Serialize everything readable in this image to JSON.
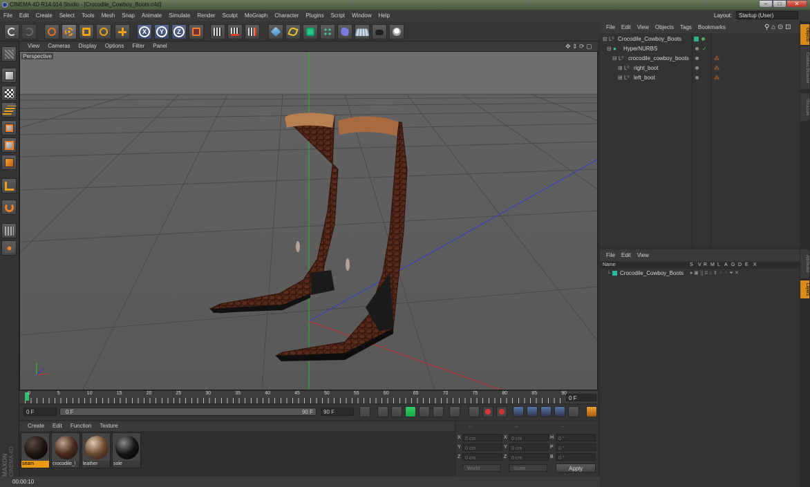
{
  "window": {
    "title": "CINEMA 4D R14.014 Studio - [Crocodile_Cowboy_Boots.c4d]",
    "controls": [
      "–",
      "□",
      "✕"
    ]
  },
  "menu": [
    "File",
    "Edit",
    "Create",
    "Select",
    "Tools",
    "Mesh",
    "Snap",
    "Animate",
    "Simulate",
    "Render",
    "Sculpt",
    "MoGraph",
    "Character",
    "Plugins",
    "Script",
    "Window",
    "Help"
  ],
  "layout": {
    "label": "Layout:",
    "value": "Startup (User)"
  },
  "toolbar": {
    "axes": [
      "X",
      "Y",
      "Z"
    ],
    "icons": [
      "undo-icon",
      "redo-icon",
      "live-selection-icon",
      "move-icon",
      "scale-icon",
      "rotate-icon",
      "add-object-icon",
      "x-axis-icon",
      "y-axis-icon",
      "z-axis-icon",
      "coordinate-system-icon",
      "render-view-icon",
      "render-picture-viewer-icon",
      "edit-render-settings-icon",
      "cube-icon",
      "spline-icon",
      "nurbs-icon",
      "array-icon",
      "deformer-icon",
      "floor-icon",
      "camera-icon",
      "light-icon"
    ]
  },
  "viewport": {
    "menu": [
      "View",
      "Cameras",
      "Display",
      "Options",
      "Filter",
      "Panel"
    ],
    "label": "Perspective"
  },
  "timeline": {
    "ticks": [
      "0",
      "5",
      "10",
      "15",
      "20",
      "25",
      "30",
      "35",
      "40",
      "45",
      "50",
      "55",
      "60",
      "65",
      "70",
      "75",
      "80",
      "85",
      "90"
    ],
    "current_frame": "0 F"
  },
  "playback": {
    "start": "0 F",
    "range_start": "0 F",
    "range_end": "90 F",
    "end": "90 F"
  },
  "materials": {
    "menu": [
      "Create",
      "Edit",
      "Function",
      "Texture"
    ],
    "items": [
      {
        "name": "seam",
        "color": "#1a1210"
      },
      {
        "name": "crocodile_l",
        "color": "#4a2a1c"
      },
      {
        "name": "leather",
        "color": "#6b4a30"
      },
      {
        "name": "sole",
        "color": "#151515"
      }
    ]
  },
  "coordinates": {
    "header": [
      "--",
      "--",
      "--"
    ],
    "rows": [
      {
        "a": "X",
        "av": "0 cm",
        "b": "X",
        "bv": "0 cm",
        "c": "H",
        "cv": "0 °"
      },
      {
        "a": "Y",
        "av": "0 cm",
        "b": "Y",
        "bv": "0 cm",
        "c": "P",
        "cv": "0 °"
      },
      {
        "a": "Z",
        "av": "0 cm",
        "b": "Z",
        "bv": "0 cm",
        "c": "B",
        "cv": "0 °"
      }
    ],
    "mode": "World",
    "mode2": "Scale",
    "apply": "Apply"
  },
  "status": "00:00:10",
  "brand": {
    "maxon": "MAXON",
    "c4d": "CINEMA 4D"
  },
  "objects": {
    "menu": [
      "File",
      "Edit",
      "View",
      "Objects",
      "Tags",
      "Bookmarks"
    ],
    "items": [
      {
        "name": "Crocodile_Cowboy_Boots"
      },
      {
        "name": "HyperNURBS"
      },
      {
        "name": "crocodile_cowboy_boots"
      },
      {
        "name": "right_boot"
      },
      {
        "name": "left_boot"
      }
    ]
  },
  "attributes": {
    "menu": [
      "File",
      "Edit",
      "View"
    ],
    "columns": [
      "Name",
      "S",
      "V",
      "R",
      "M",
      "L",
      "A",
      "G",
      "D",
      "E",
      "X"
    ],
    "row": "Crocodile_Cowboy_Boots"
  },
  "right_tabs": [
    "Objects",
    "Content Browser",
    "Structure",
    "Attributes",
    "Layers"
  ]
}
